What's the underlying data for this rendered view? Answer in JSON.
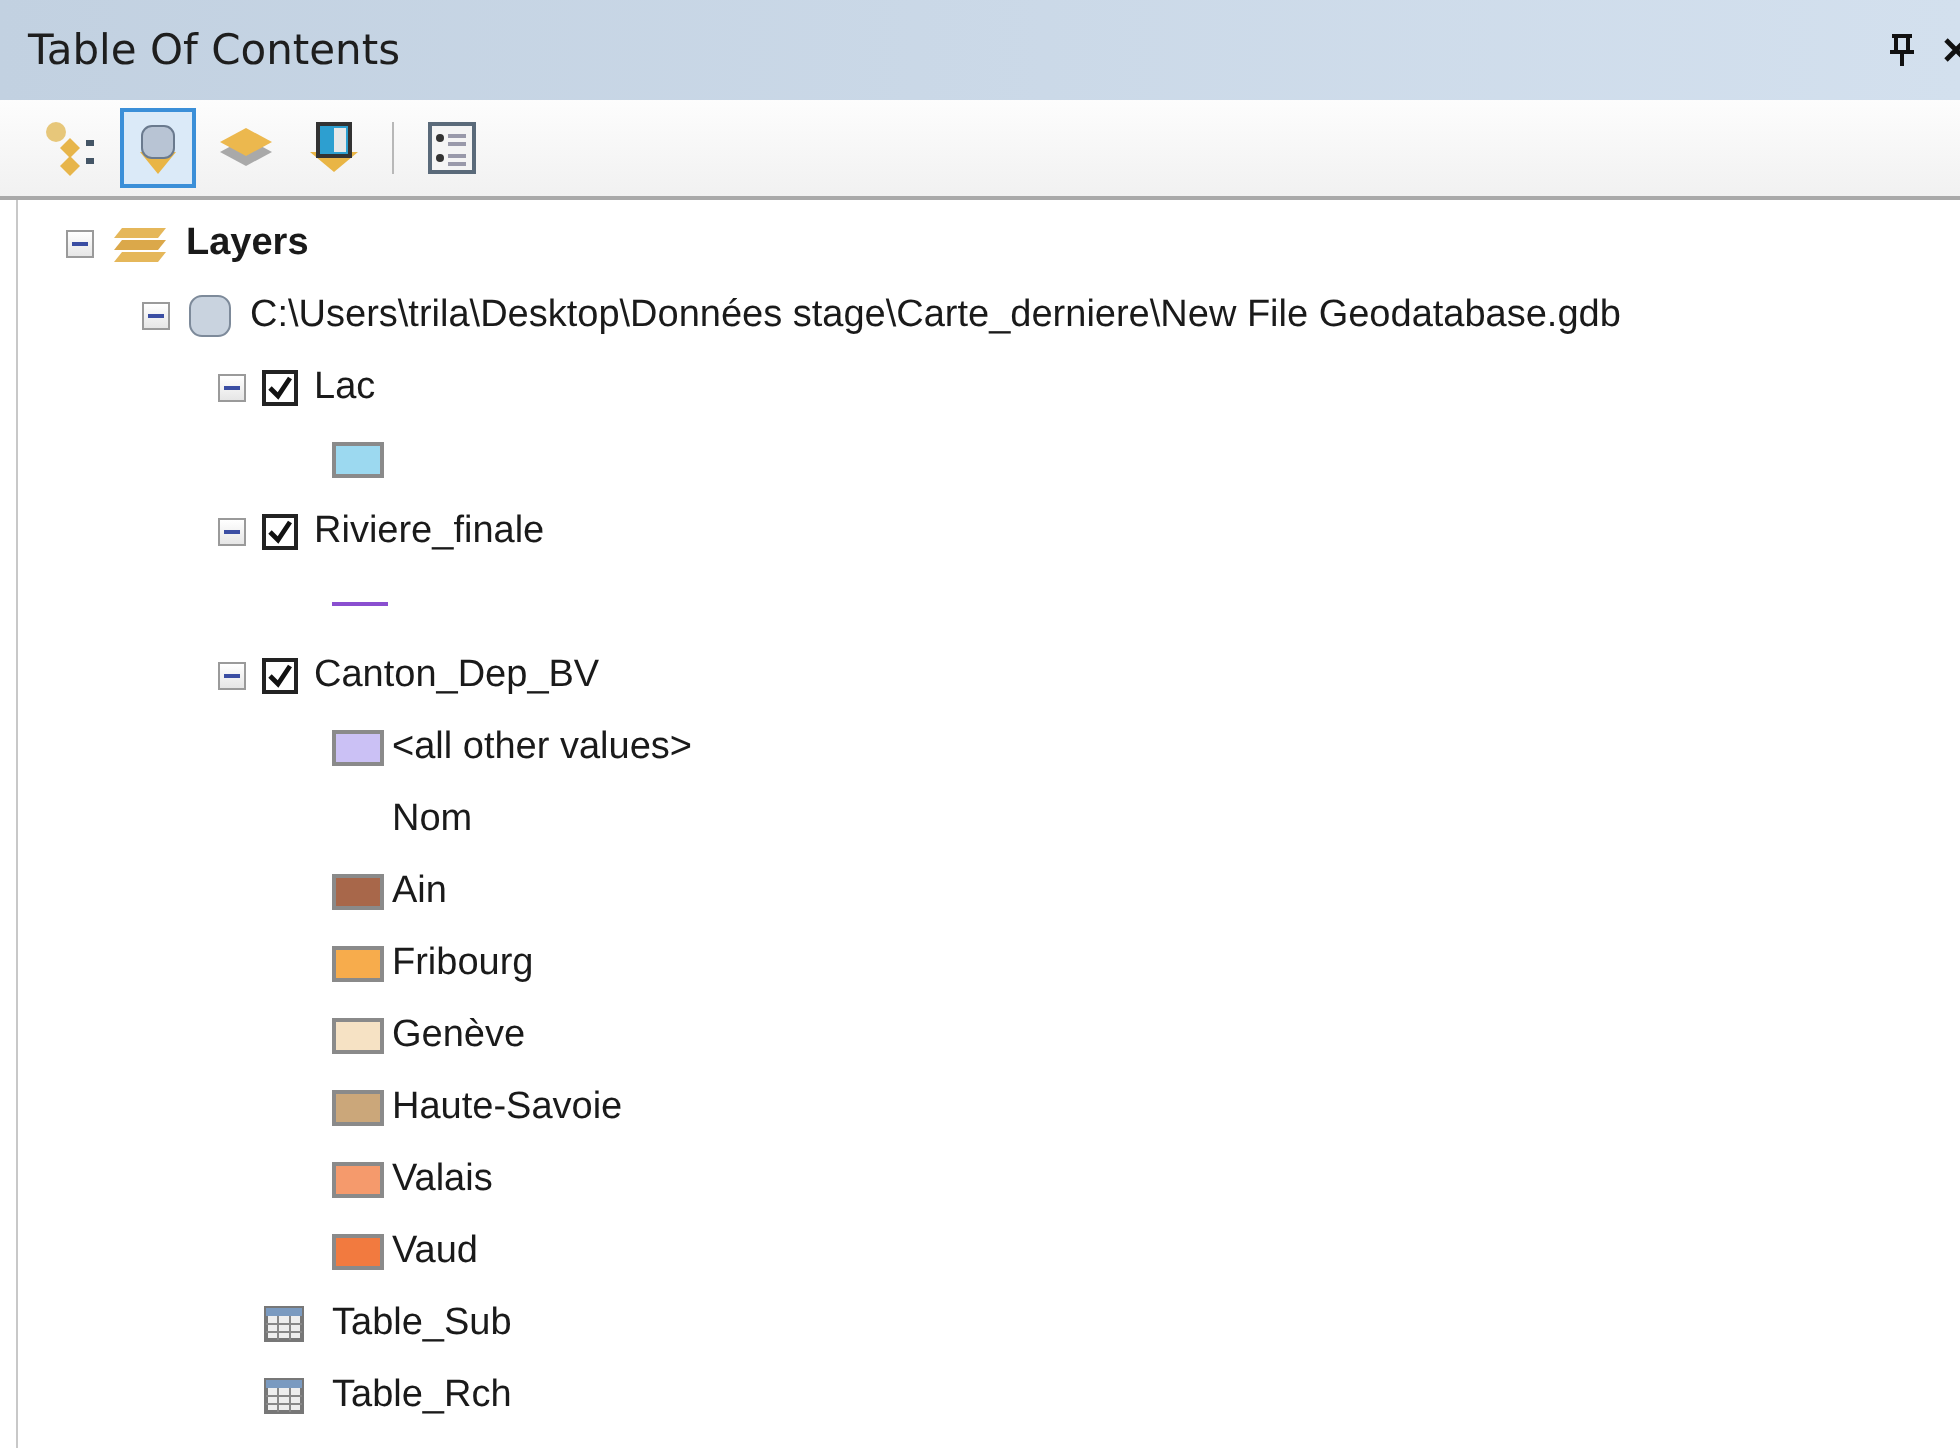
{
  "panel": {
    "title": "Table Of Contents"
  },
  "toolbar": [
    {
      "kind": "drawing-order",
      "selected": false
    },
    {
      "kind": "source",
      "selected": true
    },
    {
      "kind": "visibility",
      "selected": false
    },
    {
      "kind": "selection",
      "selected": false
    },
    {
      "kind": "options",
      "selected": false
    }
  ],
  "tree": {
    "label": "Layers",
    "expanded": true,
    "children": [
      {
        "kind": "workspace",
        "label": "C:\\Users\\trila\\Desktop\\Données stage\\Carte_derniere\\New File Geodatabase.gdb",
        "expanded": true,
        "children": [
          {
            "kind": "layer",
            "label": "Lac",
            "checked": true,
            "expanded": true,
            "legend": [
              {
                "kind": "swatch",
                "color": "#9cd9f0"
              }
            ]
          },
          {
            "kind": "layer",
            "label": "Riviere_finale",
            "checked": true,
            "expanded": true,
            "legend": [
              {
                "kind": "line",
                "color": "#8a4fd0"
              }
            ]
          },
          {
            "kind": "layer",
            "label": "Canton_Dep_BV",
            "checked": true,
            "expanded": true,
            "legend": [
              {
                "kind": "swatch",
                "color": "#cbc1f5",
                "label": "<all other values>"
              },
              {
                "kind": "heading",
                "label": "Nom"
              },
              {
                "kind": "swatch",
                "color": "#a8674a",
                "label": "Ain"
              },
              {
                "kind": "swatch",
                "color": "#f7ac4c",
                "label": "Fribourg"
              },
              {
                "kind": "swatch",
                "color": "#f6e2c4",
                "label": "Genève"
              },
              {
                "kind": "swatch",
                "color": "#cba77a",
                "label": "Haute-Savoie"
              },
              {
                "kind": "swatch",
                "color": "#f59a6c",
                "label": "Valais"
              },
              {
                "kind": "swatch",
                "color": "#f27a3f",
                "label": "Vaud"
              }
            ]
          },
          {
            "kind": "table",
            "label": "Table_Sub"
          },
          {
            "kind": "table",
            "label": "Table_Rch"
          }
        ]
      }
    ]
  }
}
